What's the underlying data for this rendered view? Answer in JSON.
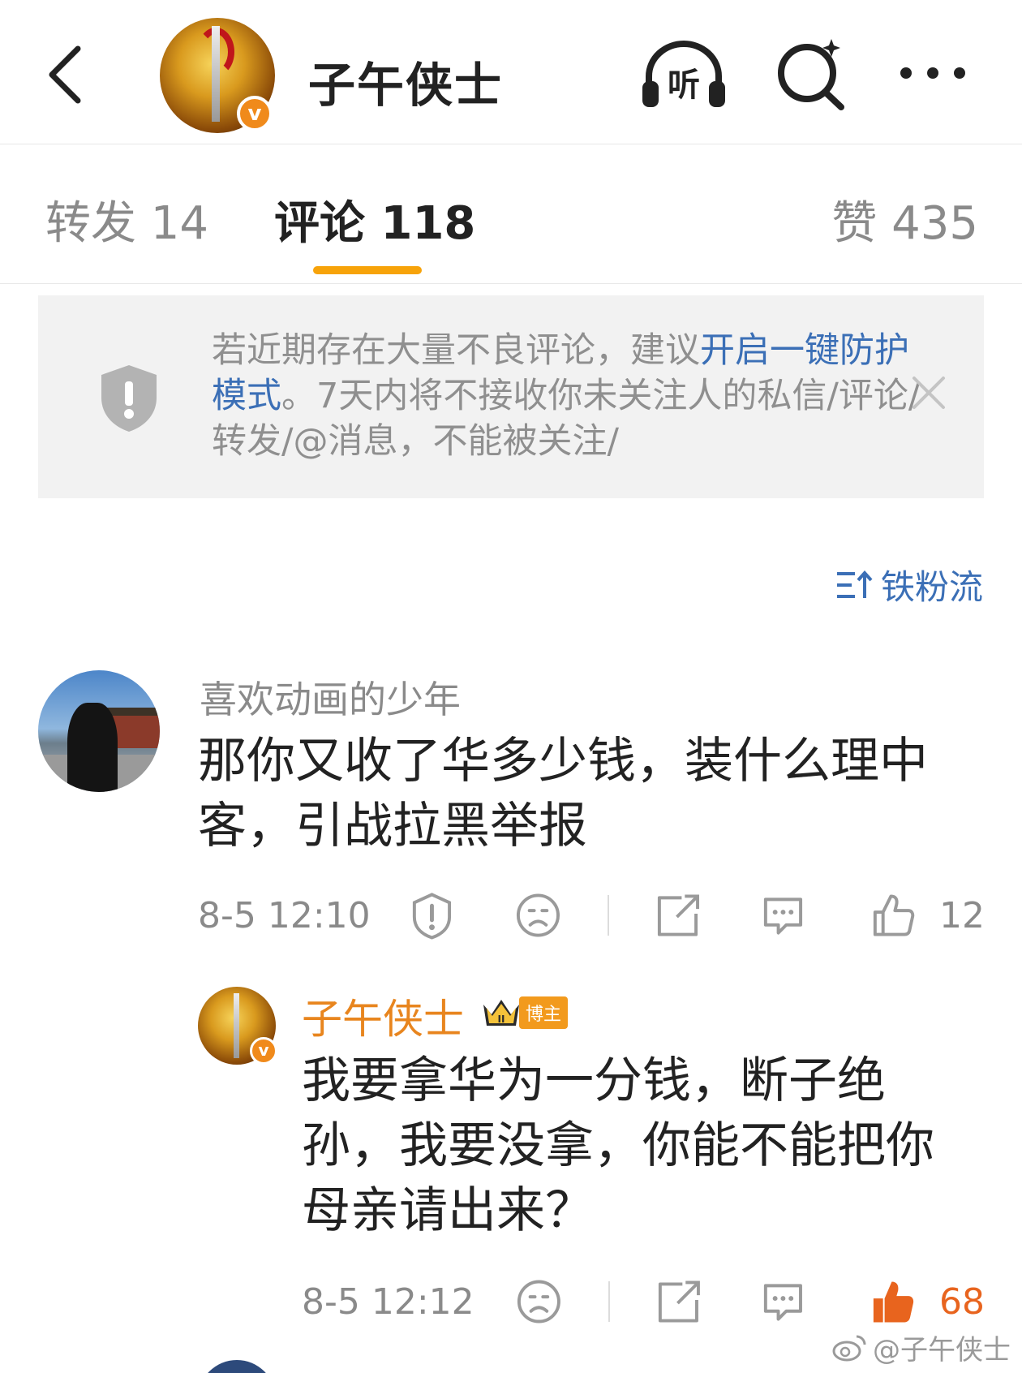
{
  "header": {
    "title": "子午侠士",
    "verified_mark": "v",
    "icons": [
      "back-icon",
      "listen-icon",
      "search-icon",
      "more-icon"
    ],
    "listen_label": "听"
  },
  "tabs": [
    {
      "label": "转发 14",
      "active": false
    },
    {
      "label": "评论 118",
      "active": true
    },
    {
      "label": "赞 435",
      "active": false
    }
  ],
  "notice": {
    "text_before": "若近期存在大量不良评论，建议",
    "link_text": "开启一键防护模式",
    "text_after": "。7天内将不接收你未关注人的私信/评论/转发/@消息，不能被关注/"
  },
  "sort": {
    "label": "铁粉流"
  },
  "comments": [
    {
      "username": "喜欢动画的少年",
      "text": "那你又收了华多少钱，装什么理中客，引战拉黑举报",
      "time": "8-5 12:10",
      "like_count": "12",
      "liked": false
    }
  ],
  "reply": {
    "username": "子午侠士",
    "badge": "博主",
    "crown_level": "II",
    "text": "我要拿华为一分钱，断子绝孙，我要没拿，你能不能把你母亲请出来？",
    "time": "8-5 12:12",
    "like_count": "68",
    "liked": true
  },
  "watermark": {
    "text": "@子午侠士"
  },
  "colors": {
    "accent_orange": "#f7a30a",
    "link_blue": "#3b6fb6",
    "liked_orange": "#e8641e",
    "author_orange": "#e8851e"
  }
}
